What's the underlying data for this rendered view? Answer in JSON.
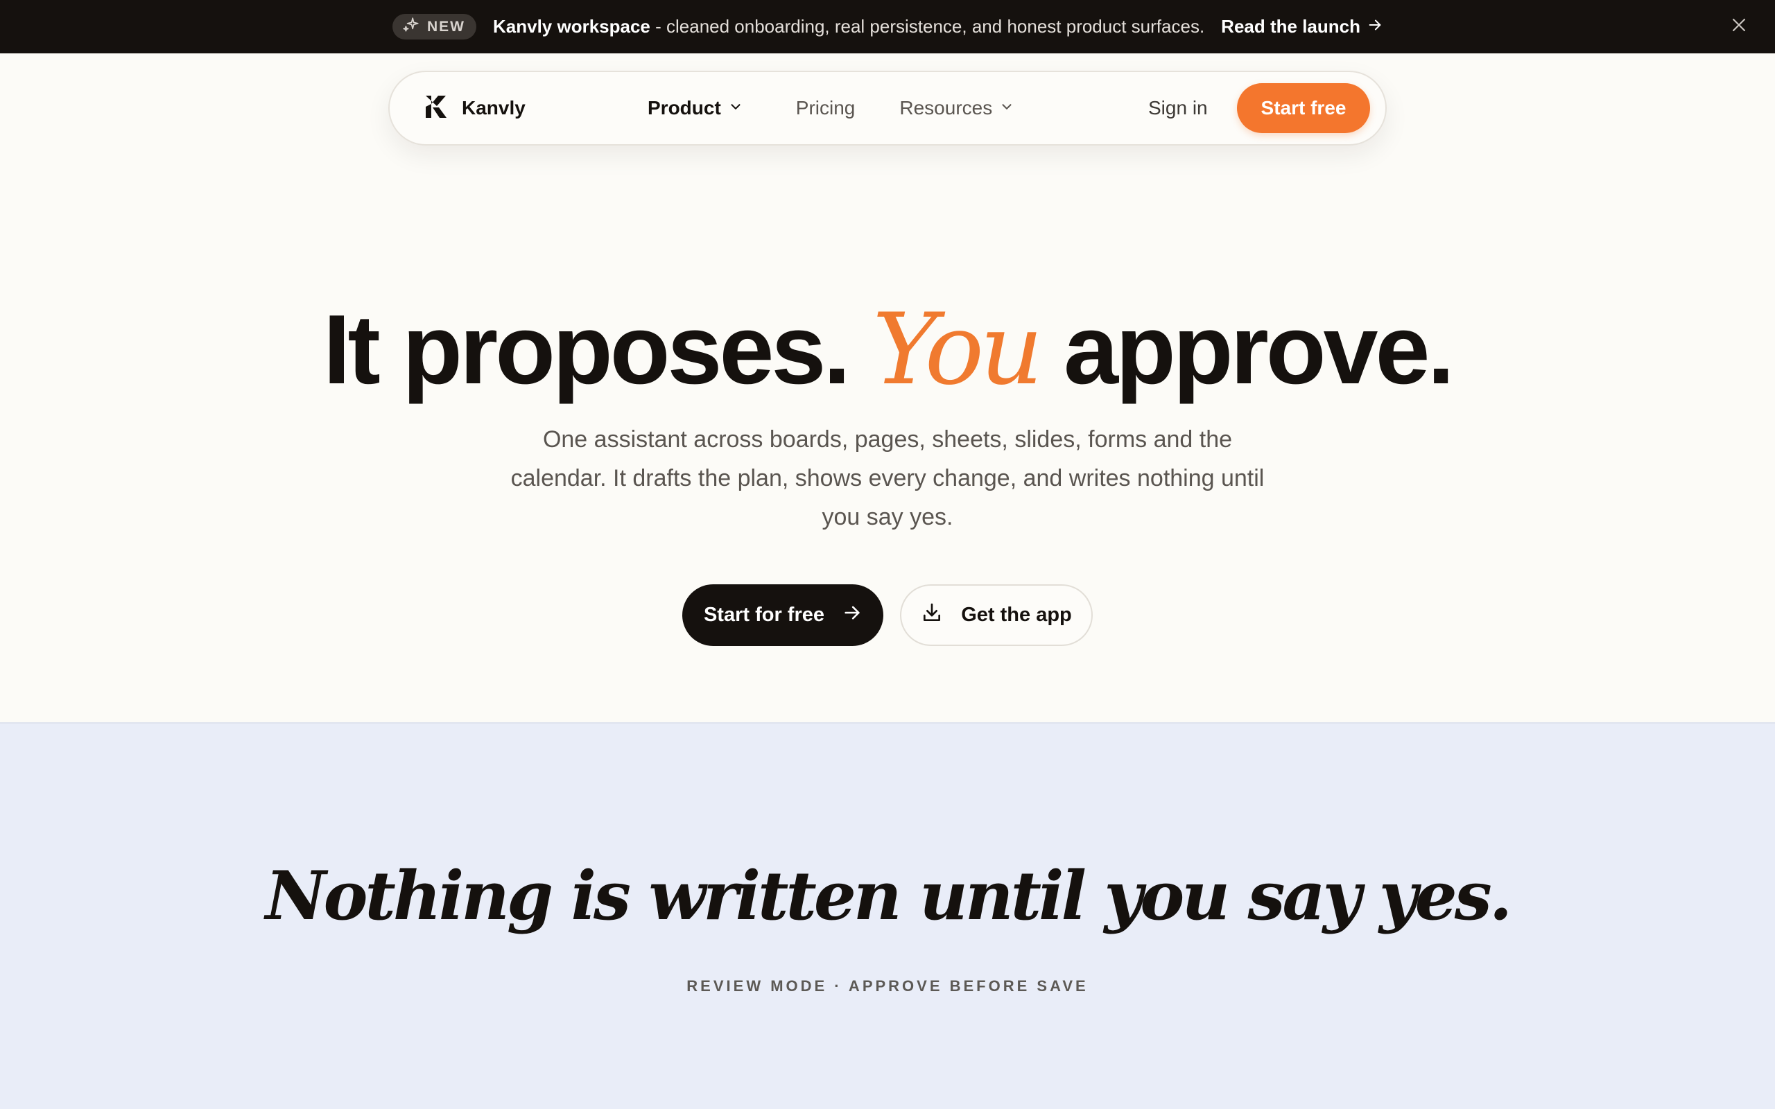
{
  "announcement": {
    "badge": "NEW",
    "headline": "Kanvly workspace",
    "text": " - cleaned onboarding, real persistence, and honest product surfaces.",
    "link_label": "Read the launch"
  },
  "nav": {
    "brand": "Kanvly",
    "links": [
      {
        "label": "Product",
        "has_dropdown": true
      },
      {
        "label": "Pricing",
        "has_dropdown": false
      },
      {
        "label": "Resources",
        "has_dropdown": true
      }
    ],
    "sign_in": "Sign in",
    "cta": "Start free"
  },
  "hero": {
    "title_before": "It proposes. ",
    "title_accent": "You",
    "title_after": " approve.",
    "subtitle_lines": [
      "One assistant across boards, pages, sheets, slides, forms and the",
      "calendar. It drafts the plan, shows every change, and writes nothing until",
      "you say yes."
    ],
    "primary_cta": "Start for free",
    "secondary_cta": "Get the app"
  },
  "review": {
    "quote": "Nothing is written until you say yes.",
    "eyebrow": "REVIEW MODE · APPROVE BEFORE SAVE"
  },
  "colors": {
    "accent": "#f4762d",
    "dark": "#15110e",
    "page_bg": "#fcfbf7",
    "section_bg": "#e9edf8"
  }
}
